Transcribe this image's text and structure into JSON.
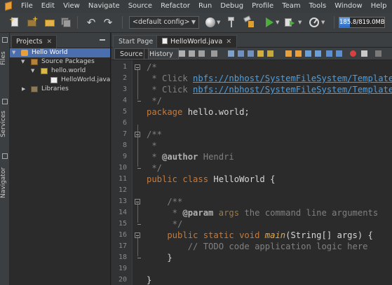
{
  "menubar": {
    "items": [
      "File",
      "Edit",
      "View",
      "Navigate",
      "Source",
      "Refactor",
      "Run",
      "Debug",
      "Profile",
      "Team",
      "Tools",
      "Window",
      "Help"
    ]
  },
  "toolbar": {
    "config_value": "<default config>",
    "memory_label": "185.8/819.0MB",
    "memory_fraction": 0.227
  },
  "sidebar": {
    "files_label": "Files",
    "services_label": "Services",
    "navigator_label": "Navigator"
  },
  "projects": {
    "tab_label": "Projects",
    "tree": [
      {
        "label": "Hello World",
        "level": 0,
        "expanded": true,
        "icon": "project-icon",
        "selected": true
      },
      {
        "label": "Source Packages",
        "level": 1,
        "expanded": true,
        "icon": "source-packages-icon"
      },
      {
        "label": "hello.world",
        "level": 2,
        "expanded": true,
        "icon": "package-icon"
      },
      {
        "label": "HelloWorld.java",
        "level": 3,
        "icon": "java-file-icon"
      },
      {
        "label": "Libraries",
        "level": 1,
        "expanded": false,
        "icon": "libraries-icon"
      }
    ]
  },
  "editor": {
    "tabs": [
      {
        "label": "Start Page",
        "active": false
      },
      {
        "label": "HelloWorld.java",
        "active": true
      }
    ],
    "source_label": "Source",
    "history_label": "History",
    "lines": [
      {
        "n": "1",
        "tokens": [
          {
            "c": "com",
            "t": "/*"
          }
        ]
      },
      {
        "n": "2",
        "tokens": [
          {
            "c": "com",
            "t": " * Click "
          },
          {
            "c": "link",
            "t": "nbfs://nbhost/SystemFileSystem/Templates/"
          }
        ]
      },
      {
        "n": "3",
        "tokens": [
          {
            "c": "com",
            "t": " * Click "
          },
          {
            "c": "link",
            "t": "nbfs://nbhost/SystemFileSystem/Templates/"
          }
        ]
      },
      {
        "n": "4",
        "tokens": [
          {
            "c": "com",
            "t": " */"
          }
        ]
      },
      {
        "n": "5",
        "tokens": [
          {
            "c": "kw",
            "t": "package"
          },
          {
            "c": "plain",
            "t": " hello.world;"
          }
        ]
      },
      {
        "n": "6",
        "tokens": []
      },
      {
        "n": "7",
        "tokens": [
          {
            "c": "com",
            "t": "/**"
          }
        ]
      },
      {
        "n": "8",
        "tokens": [
          {
            "c": "com",
            "t": " *"
          }
        ]
      },
      {
        "n": "9",
        "tokens": [
          {
            "c": "com",
            "t": " * "
          },
          {
            "c": "tag",
            "t": "@author"
          },
          {
            "c": "com",
            "t": " Hendri"
          }
        ]
      },
      {
        "n": "10",
        "tokens": [
          {
            "c": "com",
            "t": " */"
          }
        ]
      },
      {
        "n": "11",
        "tokens": [
          {
            "c": "kw",
            "t": "public class"
          },
          {
            "c": "plain",
            "t": " HelloWorld {"
          }
        ]
      },
      {
        "n": "12",
        "tokens": []
      },
      {
        "n": "13",
        "tokens": [
          {
            "c": "com",
            "t": "    /**"
          }
        ]
      },
      {
        "n": "14",
        "tokens": [
          {
            "c": "com",
            "t": "     * "
          },
          {
            "c": "tag",
            "t": "@param"
          },
          {
            "c": "com",
            "t": " "
          },
          {
            "c": "param",
            "t": "args"
          },
          {
            "c": "com",
            "t": " the command line arguments"
          }
        ]
      },
      {
        "n": "15",
        "tokens": [
          {
            "c": "com",
            "t": "     */"
          }
        ]
      },
      {
        "n": "16",
        "tokens": [
          {
            "c": "kw",
            "t": "    public static void "
          },
          {
            "c": "method",
            "t": "main"
          },
          {
            "c": "plain",
            "t": "(String[] args) {"
          }
        ]
      },
      {
        "n": "17",
        "tokens": [
          {
            "c": "com",
            "t": "        // TODO code application logic here"
          }
        ]
      },
      {
        "n": "18",
        "tokens": [
          {
            "c": "plain",
            "t": "    }"
          }
        ]
      },
      {
        "n": "19",
        "tokens": []
      },
      {
        "n": "20",
        "tokens": [
          {
            "c": "plain",
            "t": "}"
          }
        ]
      }
    ]
  }
}
